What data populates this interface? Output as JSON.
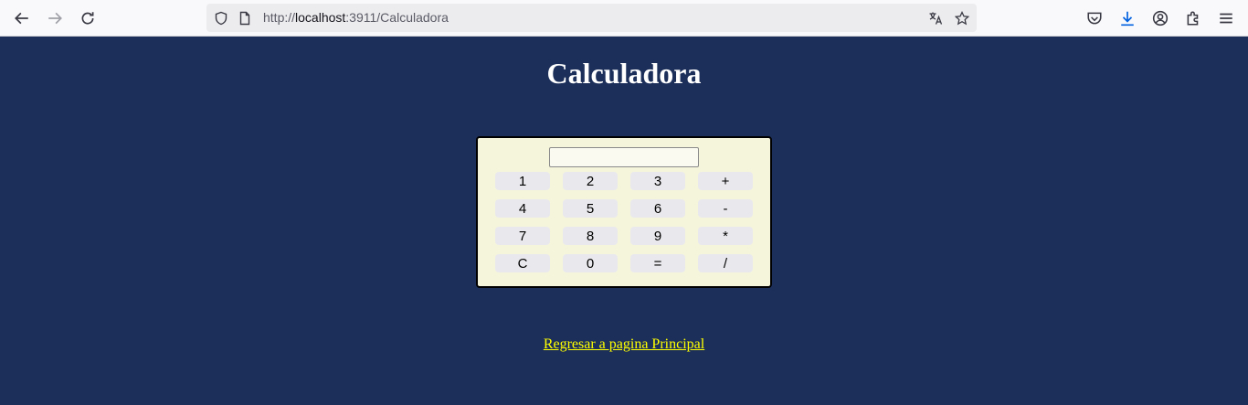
{
  "browser": {
    "url_protocol": "http://",
    "url_host": "localhost",
    "url_rest": ":3911/Calculadora"
  },
  "page": {
    "title": "Calculadora",
    "display_value": "",
    "keys": [
      "1",
      "2",
      "3",
      "+",
      "4",
      "5",
      "6",
      "-",
      "7",
      "8",
      "9",
      "*",
      "C",
      "0",
      "=",
      "/"
    ],
    "back_link": "Regresar a pagina Principal"
  },
  "colors": {
    "background": "#1b2f5a",
    "calculator_bg": "#f5f5dc",
    "link": "#ffff00"
  }
}
